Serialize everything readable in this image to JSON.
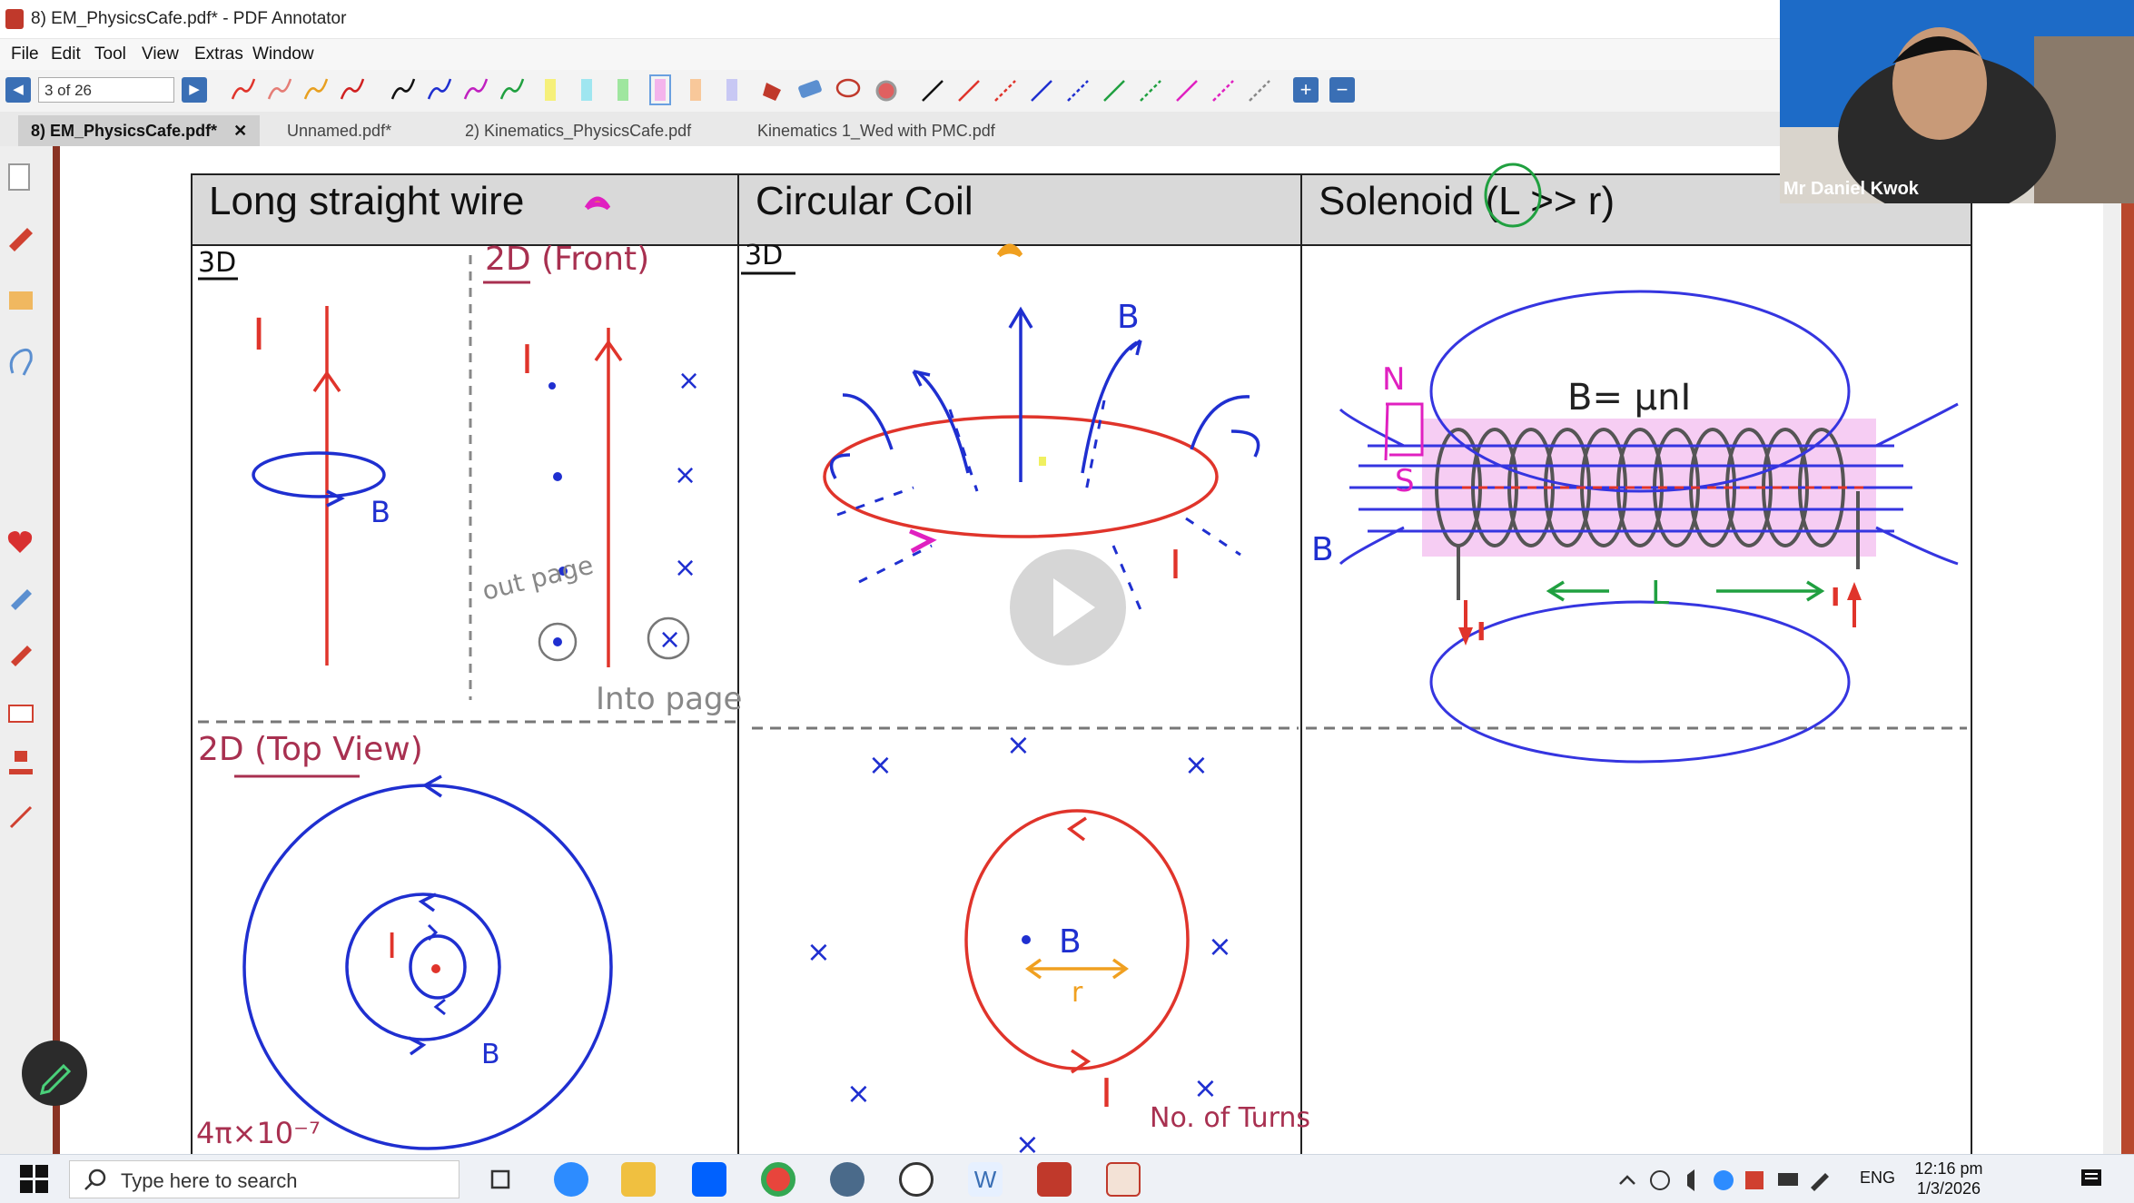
{
  "window": {
    "title": "8) EM_PhysicsCafe.pdf* - PDF Annotator"
  },
  "menu": [
    "File",
    "Edit",
    "Tool",
    "View",
    "Extras",
    "Window"
  ],
  "toolbar": {
    "page_indicator": "3 of 26"
  },
  "tabs": [
    {
      "label": "8) EM_PhysicsCafe.pdf*",
      "active": true
    },
    {
      "label": "Unnamed.pdf*",
      "active": false
    },
    {
      "label": "2) Kinematics_PhysicsCafe.pdf",
      "active": false
    },
    {
      "label": "Kinematics 1_Wed with PMC.pdf",
      "active": false
    }
  ],
  "document": {
    "headers": [
      "Long straight wire",
      "Circular Coil",
      "Solenoid (L >> r)"
    ],
    "formula": "B= µnI",
    "annotations": {
      "wire_3d_tag": "3D",
      "wire_2d_tag": "2D (Front)",
      "coil_3d_tag": "3D",
      "top_view_tag": "2D (Top View)",
      "current": "I",
      "field": "B",
      "out_page": "out page",
      "into_page": "Into page",
      "N": "N",
      "S": "S",
      "L": "L",
      "r": "r",
      "permeability": "4π×10⁻⁷",
      "turns": "No. of Turns"
    }
  },
  "video": {
    "participant": "Mr Daniel Kwok"
  },
  "taskbar": {
    "search_placeholder": "Type here to search",
    "language": "ENG",
    "time": "12:16 pm",
    "date": "1/3/2026"
  },
  "colors": {
    "accent": "#b8482d",
    "nav_blue": "#3a6fb5",
    "ink_blue": "#1f2fd0",
    "ink_red": "#e0342b"
  }
}
